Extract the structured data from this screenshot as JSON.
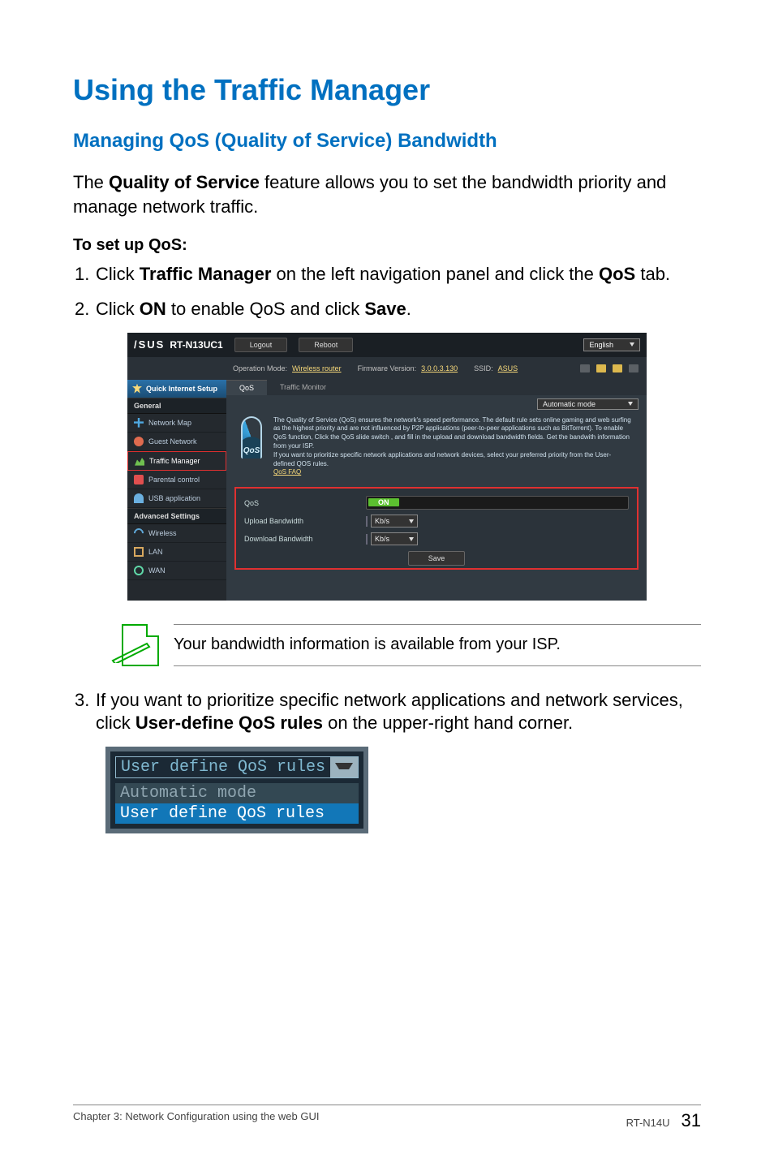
{
  "heading1": "Using the Traffic Manager",
  "heading2": "Managing QoS (Quality of Service) Bandwidth",
  "intro_a": "The ",
  "intro_bold": "Quality of Service",
  "intro_b": " feature allows you to set the bandwidth priority and manage network traffic.",
  "setup_heading": "To set up QoS:",
  "step1_a": "Click ",
  "step1_bold1": "Traffic Manager",
  "step1_b": " on the left navigation panel and click the ",
  "step1_bold2": "QoS",
  "step1_c": " tab.",
  "step2_a": "Click ",
  "step2_bold1": "ON",
  "step2_b": " to enable QoS and click ",
  "step2_bold2": "Save",
  "step2_c": ".",
  "note_text": "Your bandwidth information is available from your ISP.",
  "step3_a": "If you want to prioritize specific network applications and network services, click ",
  "step3_bold": "User-define QoS rules",
  "step3_b": " on the upper-right hand corner.",
  "router": {
    "brand": "/SUS",
    "model": "RT-N13UC1",
    "logout": "Logout",
    "reboot": "Reboot",
    "lang": "English",
    "op_mode_label": "Operation Mode:",
    "op_mode_val": "Wireless router",
    "fw_label": "Firmware Version:",
    "fw_val": "3.0.0.3.130",
    "ssid_label": "SSID:",
    "ssid_val": "ASUS",
    "side": {
      "quick": "Quick Internet Setup",
      "general": "General",
      "netmap": "Network Map",
      "guest": "Guest Network",
      "traffic": "Traffic Manager",
      "parental": "Parental control",
      "usb": "USB application",
      "adv": "Advanced Settings",
      "wireless": "Wireless",
      "lan": "LAN",
      "wan": "WAN"
    },
    "tabs": {
      "qos": "QoS",
      "tm": "Traffic Monitor"
    },
    "mode_select": "Automatic mode",
    "desc": "The Quality of Service (QoS) ensures the network's speed performance. The default rule sets online gaming and web surfing as the highest priority and are not influenced by P2P applications (peer-to-peer applications such as BitTorrent). To enable QoS function, Click the QoS slide switch , and fill in the upload and download bandwidth fields. Get the bandwith information from your ISP.",
    "desc2": "If you want to prioritize specific network applications and network devices, select your preferred priority from the User-defined QOS rules.",
    "faq": "QoS FAQ",
    "form": {
      "qos_label": "QoS",
      "on": "ON",
      "upload": "Upload Bandwidth",
      "download": "Download Bandwidth",
      "unit": "Kb/s",
      "save": "Save"
    }
  },
  "dropdown": {
    "selected": "User define QoS rules",
    "opt1": "Automatic mode",
    "opt2": "User define QoS rules"
  },
  "footer": {
    "chapter": "Chapter 3: Network Configuration using the web GUI",
    "device": "RT-N14U",
    "page": "31"
  }
}
